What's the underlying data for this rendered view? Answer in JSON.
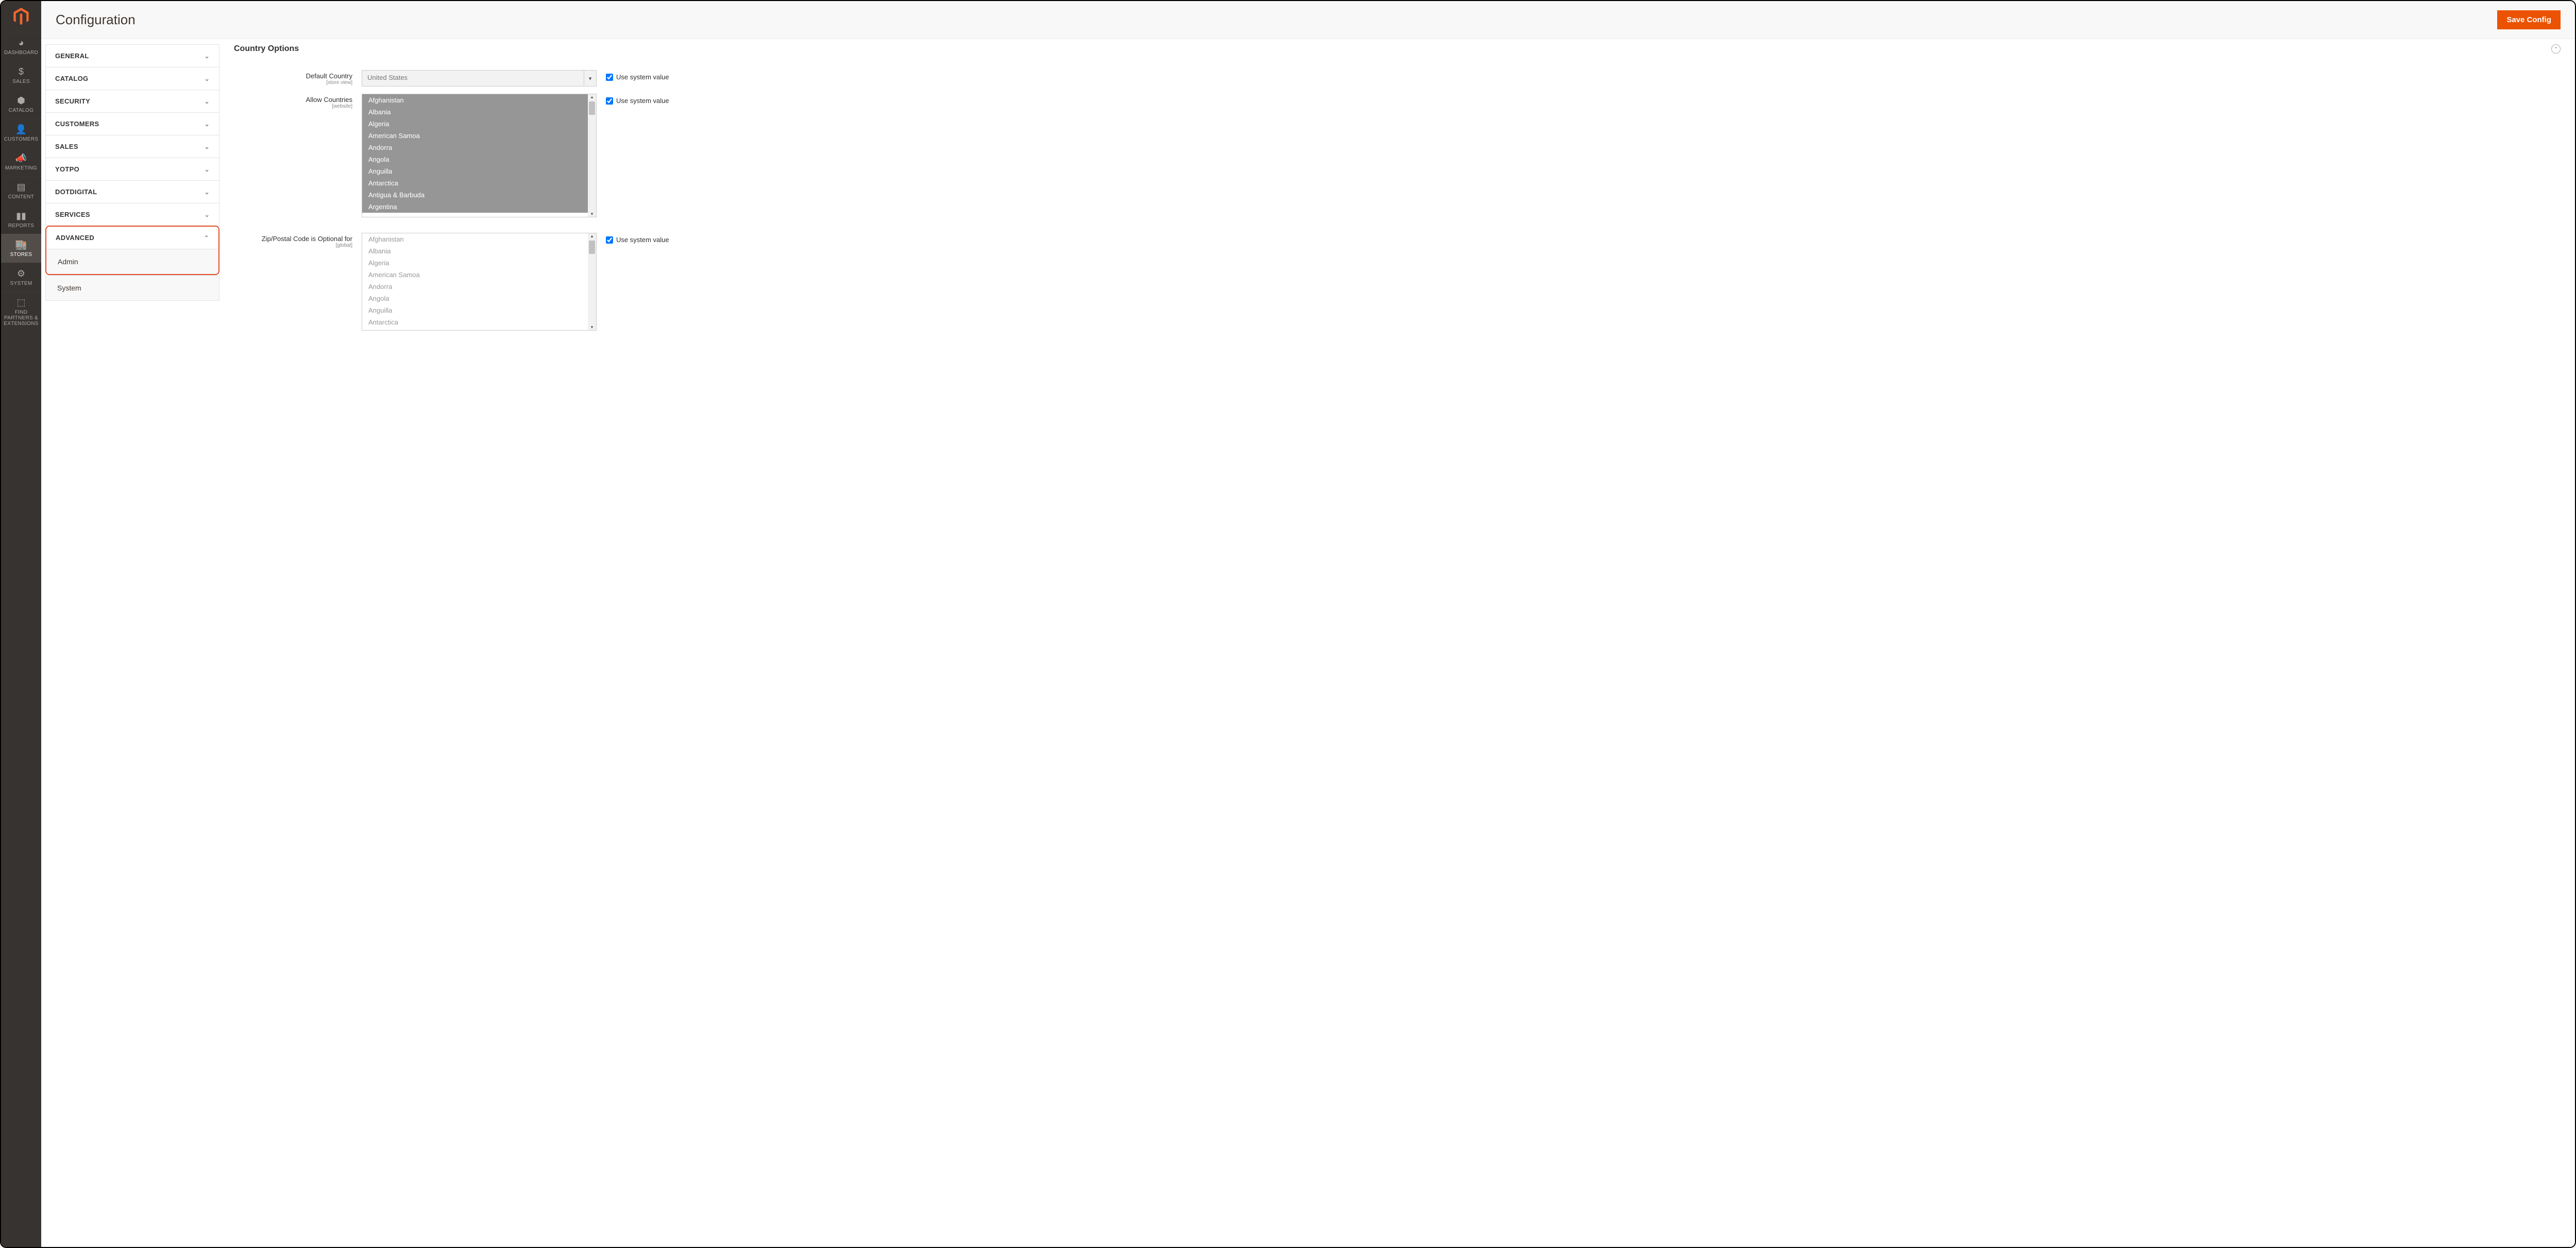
{
  "header": {
    "page_title": "Configuration",
    "save_label": "Save Config"
  },
  "sidebar_nav": {
    "dashboard": "DASHBOARD",
    "sales": "SALES",
    "catalog": "CATALOG",
    "customers": "CUSTOMERS",
    "marketing": "MARKETING",
    "content": "CONTENT",
    "reports": "REPORTS",
    "stores": "STORES",
    "system": "SYSTEM",
    "partners": "FIND PARTNERS & EXTENSIONS"
  },
  "config_nav": {
    "general": "GENERAL",
    "catalog": "CATALOG",
    "security": "SECURITY",
    "customers": "CUSTOMERS",
    "sales": "SALES",
    "yotpo": "YOTPO",
    "dotdigital": "DOTDIGITAL",
    "services": "SERVICES",
    "advanced": "ADVANCED",
    "advanced_items": {
      "admin": "Admin",
      "system": "System"
    }
  },
  "section": {
    "title": "Country Options"
  },
  "fields": {
    "default_country": {
      "label": "Default Country",
      "scope": "[store view]",
      "value": "United States",
      "use_system": "Use system value",
      "checked": true
    },
    "allow_countries": {
      "label": "Allow Countries",
      "scope": "[website]",
      "use_system": "Use system value",
      "checked": true,
      "options": [
        "Afghanistan",
        "Albania",
        "Algeria",
        "American Samoa",
        "Andorra",
        "Angola",
        "Anguilla",
        "Antarctica",
        "Antigua & Barbuda",
        "Argentina"
      ]
    },
    "zip_optional": {
      "label": "Zip/Postal Code is Optional for",
      "scope": "[global]",
      "use_system": "Use system value",
      "checked": true,
      "options": [
        "Afghanistan",
        "Albania",
        "Algeria",
        "American Samoa",
        "Andorra",
        "Angola",
        "Anguilla",
        "Antarctica"
      ]
    }
  }
}
